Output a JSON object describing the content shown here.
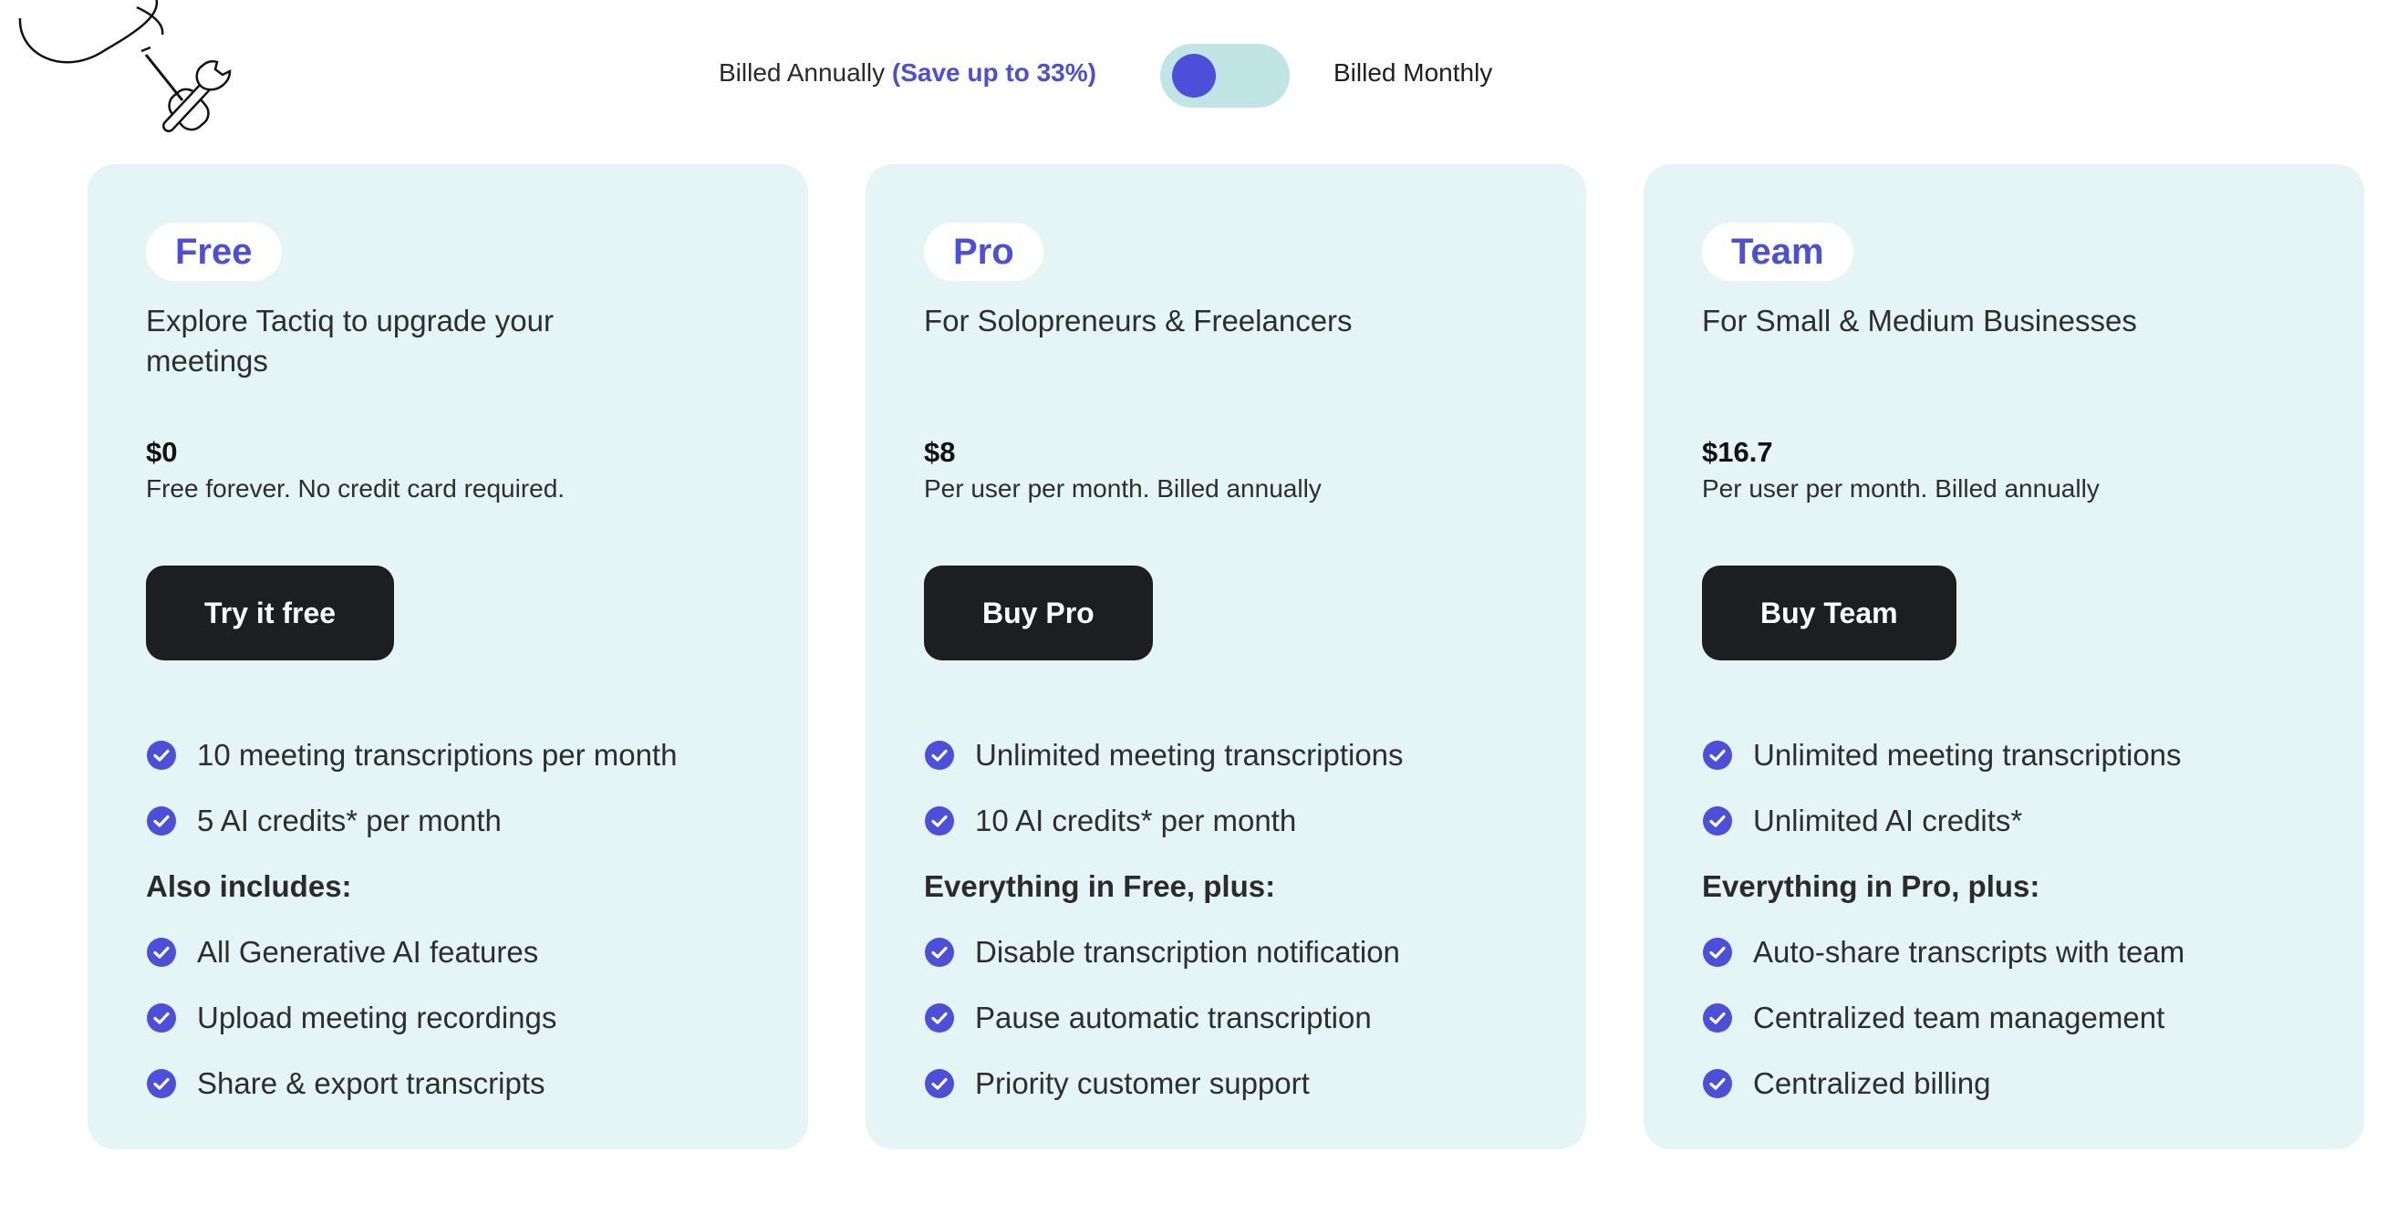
{
  "billing": {
    "annual_label": "Billed Annually",
    "save_label": "(Save up to 33%)",
    "monthly_label": "Billed Monthly"
  },
  "colors": {
    "accent": "#4b4fd9",
    "card_bg": "#e5f4f4",
    "toggle_track": "#bfe6e5",
    "button_bg": "#1d1e20"
  },
  "plans": [
    {
      "name": "Free",
      "tagline": "Explore Tactiq to upgrade your meetings",
      "price": "$0",
      "price_note": "Free forever. No credit card required.",
      "cta": "Try it free",
      "features": [
        {
          "text": "10 meeting transcriptions per month",
          "kind": "check"
        },
        {
          "text": "5 AI credits* per month",
          "kind": "check"
        },
        {
          "text": "Also includes:",
          "kind": "heading"
        },
        {
          "text": "All Generative AI features",
          "kind": "check"
        },
        {
          "text": "Upload meeting recordings",
          "kind": "check"
        },
        {
          "text": "Share & export transcripts",
          "kind": "check"
        }
      ]
    },
    {
      "name": "Pro",
      "tagline": "For Solopreneurs & Freelancers",
      "price": "$8",
      "price_note": "Per user per month. Billed annually",
      "cta": "Buy Pro",
      "features": [
        {
          "text": "Unlimited meeting transcriptions",
          "kind": "check"
        },
        {
          "text": "10 AI credits* per month",
          "kind": "check"
        },
        {
          "text": "Everything in Free, plus:",
          "kind": "heading"
        },
        {
          "text": "Disable transcription notification",
          "kind": "check"
        },
        {
          "text": "Pause automatic transcription",
          "kind": "check"
        },
        {
          "text": "Priority customer support",
          "kind": "check"
        }
      ]
    },
    {
      "name": "Team",
      "tagline": "For Small & Medium Businesses",
      "price": "$16.7",
      "price_note": "Per user per month. Billed annually",
      "cta": "Buy Team",
      "features": [
        {
          "text": "Unlimited meeting transcriptions",
          "kind": "check"
        },
        {
          "text": "Unlimited AI credits*",
          "kind": "check"
        },
        {
          "text": "Everything in Pro, plus:",
          "kind": "heading"
        },
        {
          "text": "Auto-share transcripts with team",
          "kind": "check"
        },
        {
          "text": "Centralized team management",
          "kind": "check"
        },
        {
          "text": "Centralized billing",
          "kind": "check"
        }
      ]
    }
  ]
}
